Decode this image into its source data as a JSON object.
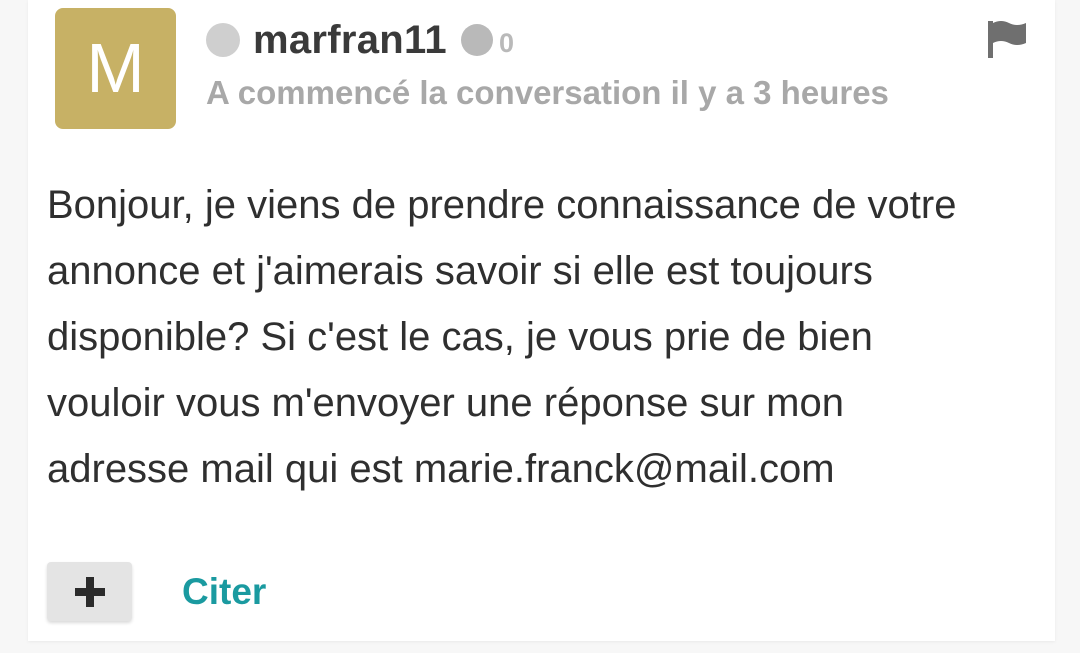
{
  "author": {
    "avatar_letter": "M",
    "avatar_color": "#c7b165",
    "username": "marfran11",
    "reputation": "0",
    "status_color": "#cfcfcf"
  },
  "header": {
    "subtitle": "A commencé la conversation il y a 3 heures",
    "flag_icon": "flag-icon"
  },
  "message": {
    "lines": [
      "Bonjour, je viens de prendre connaissance de votre",
      "annonce et j'aimerais savoir si elle est toujours",
      "disponible? Si c'est le cas, je vous prie de bien",
      "vouloir vous m'envoyer une réponse sur mon",
      "adresse mail qui est marie.franck@mail.com"
    ]
  },
  "actions": {
    "plus_icon": "plus-icon",
    "cite_label": "Citer",
    "accent_color": "#1a9aa0"
  }
}
